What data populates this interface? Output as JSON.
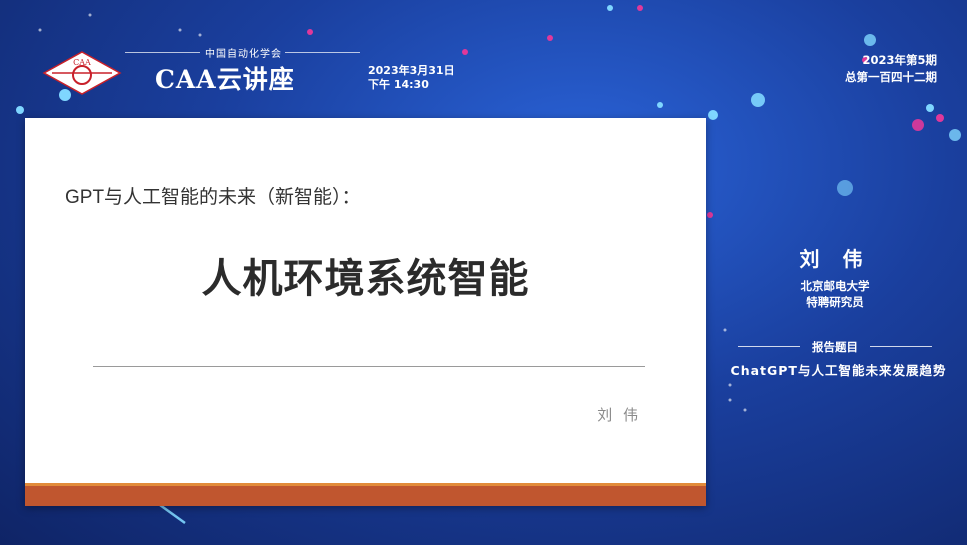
{
  "header": {
    "org_name": "中国自动化学会",
    "brand": "CAA云讲座",
    "logo_text": "CAA",
    "date_line1": "2023年3月31日",
    "date_line2": "下午 14:30"
  },
  "issue": {
    "line1": "2023年第5期",
    "line2": "总第一百四十二期"
  },
  "slide": {
    "subtitle": "GPT与人工智能的未来（新智能）：",
    "title": "人机环境系统智能",
    "author": "刘 伟"
  },
  "speaker": {
    "name": "刘 伟",
    "affiliation": "北京邮电大学",
    "role": "特聘研究员"
  },
  "topic": {
    "header": "报告题目",
    "title": "ChatGPT与人工智能未来发展趋势"
  },
  "colors": {
    "background": "#1a3f9e",
    "slide_bar": "#c0562f",
    "slide_bar_accent": "#e28b3a",
    "logo_red": "#c8202a"
  }
}
